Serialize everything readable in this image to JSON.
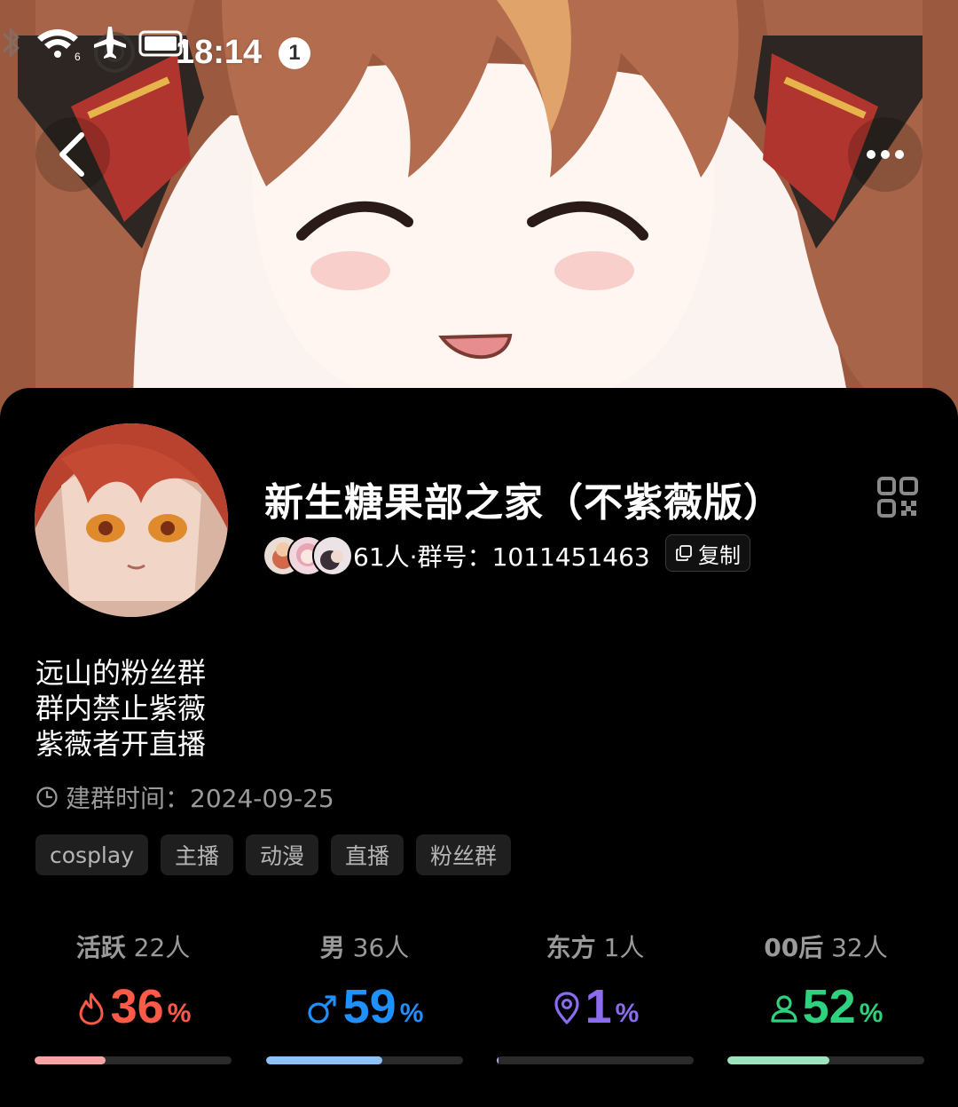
{
  "status_bar": {
    "time": "18:14",
    "notification_count": "1",
    "icons": [
      "bluetooth-icon",
      "wifi-icon",
      "airplane-mode-icon",
      "battery-icon"
    ]
  },
  "nav": {
    "back_icon": "chevron-left-icon",
    "more_icon": "more-horizontal-icon"
  },
  "group": {
    "name": "新生糖果部之家（不紫薇版）",
    "member_count": "61人",
    "separator": "·",
    "group_id_label": "群号：",
    "group_id": "1011451463",
    "copy_label": "复制",
    "description": [
      "远山的粉丝群",
      "群内禁止紫薇",
      "紫薇者开直播"
    ],
    "created_label": "建群时间：",
    "created_date": "2024-09-25",
    "tags": [
      "cosplay",
      "主播",
      "动漫",
      "直播",
      "粉丝群"
    ]
  },
  "stats": [
    {
      "label": "活跃",
      "count": "22人",
      "value": "36",
      "unit": "%",
      "fraction": 0.36,
      "color": "#ff5a47",
      "bar_color": "#f7a3a3",
      "icon": "flame-icon"
    },
    {
      "label": "男",
      "count": "36人",
      "value": "59",
      "unit": "%",
      "fraction": 0.59,
      "color": "#1e90ff",
      "bar_color": "#8ec2f7",
      "icon": "male-icon"
    },
    {
      "label": "东方",
      "count": "1人",
      "value": "1",
      "unit": "%",
      "fraction": 0.01,
      "color": "#8b6cf0",
      "bar_color": "#b9a8f5",
      "icon": "location-pin-icon"
    },
    {
      "label": "00后",
      "count": "32人",
      "value": "52",
      "unit": "%",
      "fraction": 0.52,
      "color": "#2fd17f",
      "bar_color": "#9ee3bd",
      "icon": "person-icon"
    }
  ]
}
